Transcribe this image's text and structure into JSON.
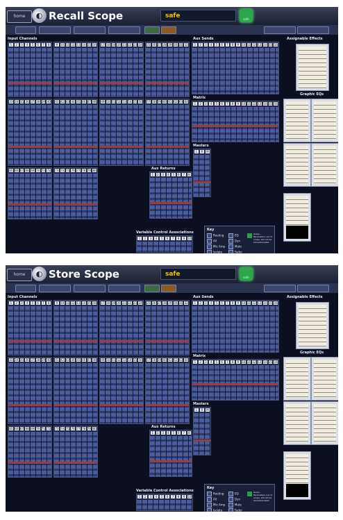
{
  "top": {
    "title": "Recall Scope",
    "status": "safe",
    "home_btn": "home",
    "led_label": "safe"
  },
  "bottom": {
    "title": "Store Scope",
    "status": "safe",
    "home_btn": "home",
    "led_label": "safe"
  },
  "sections": {
    "input_channels": "Input Channels",
    "aux_sends": "Aux Sends",
    "assignable_effects": "Assignable Effects",
    "matrix": "Matrix",
    "graphic_eqs": "Graphic EQs",
    "masters": "Masters",
    "aux_returns": "Aux Returns",
    "variable_control": "Variable Control Associations",
    "key": "Key"
  },
  "input_groups": [
    [
      "1",
      "2",
      "3",
      "4",
      "5",
      "6",
      "7",
      "8"
    ],
    [
      "9",
      "10",
      "11",
      "12",
      "13",
      "14",
      "15",
      "16"
    ],
    [
      "17",
      "18",
      "19",
      "20",
      "21",
      "22",
      "23",
      "24"
    ],
    [
      "25",
      "26",
      "27",
      "28",
      "29",
      "30",
      "31",
      "32"
    ],
    [
      "33",
      "34",
      "35",
      "36",
      "37",
      "38",
      "39",
      "40"
    ],
    [
      "41",
      "42",
      "43",
      "44",
      "45",
      "46",
      "47",
      "48"
    ],
    [
      "49",
      "50",
      "51",
      "52",
      "53",
      "54",
      "55",
      "56"
    ],
    [
      "57",
      "58",
      "59",
      "60",
      "61",
      "62",
      "63",
      "64"
    ],
    [
      "65",
      "66",
      "67",
      "68",
      "69",
      "70",
      "71",
      "72"
    ],
    [
      "73",
      "74",
      "75",
      "76",
      "77",
      "78",
      "79",
      "80"
    ]
  ],
  "aux_numbers": [
    "1",
    "2",
    "3",
    "4",
    "5",
    "6",
    "7",
    "8",
    "9",
    "10",
    "11",
    "12",
    "13",
    "14",
    "15",
    "16"
  ],
  "matrix_numbers": [
    "1",
    "2",
    "3",
    "4",
    "5",
    "6",
    "7",
    "8",
    "9",
    "10",
    "11",
    "12",
    "13",
    "14",
    "15",
    "16"
  ],
  "master_numbers": [
    "L",
    "R",
    "M"
  ],
  "return_numbers": [
    "1",
    "2",
    "3",
    "4",
    "5",
    "6",
    "7",
    "8"
  ],
  "vca_numbers": [
    "1",
    "2",
    "3",
    "4",
    "5",
    "6",
    "7",
    "8",
    "9",
    "10"
  ],
  "key_items": [
    "Routing",
    "All",
    "Mic Amp",
    "Isolate",
    "EQ",
    "Dyn",
    "Mute",
    "Fader"
  ],
  "key_green": "Green - Parameters out of scope, will not be stored/recalled",
  "colors": {
    "screen_bg": "#0b0f1f",
    "status_text": "#f2c400",
    "led": "#2aa84a"
  }
}
